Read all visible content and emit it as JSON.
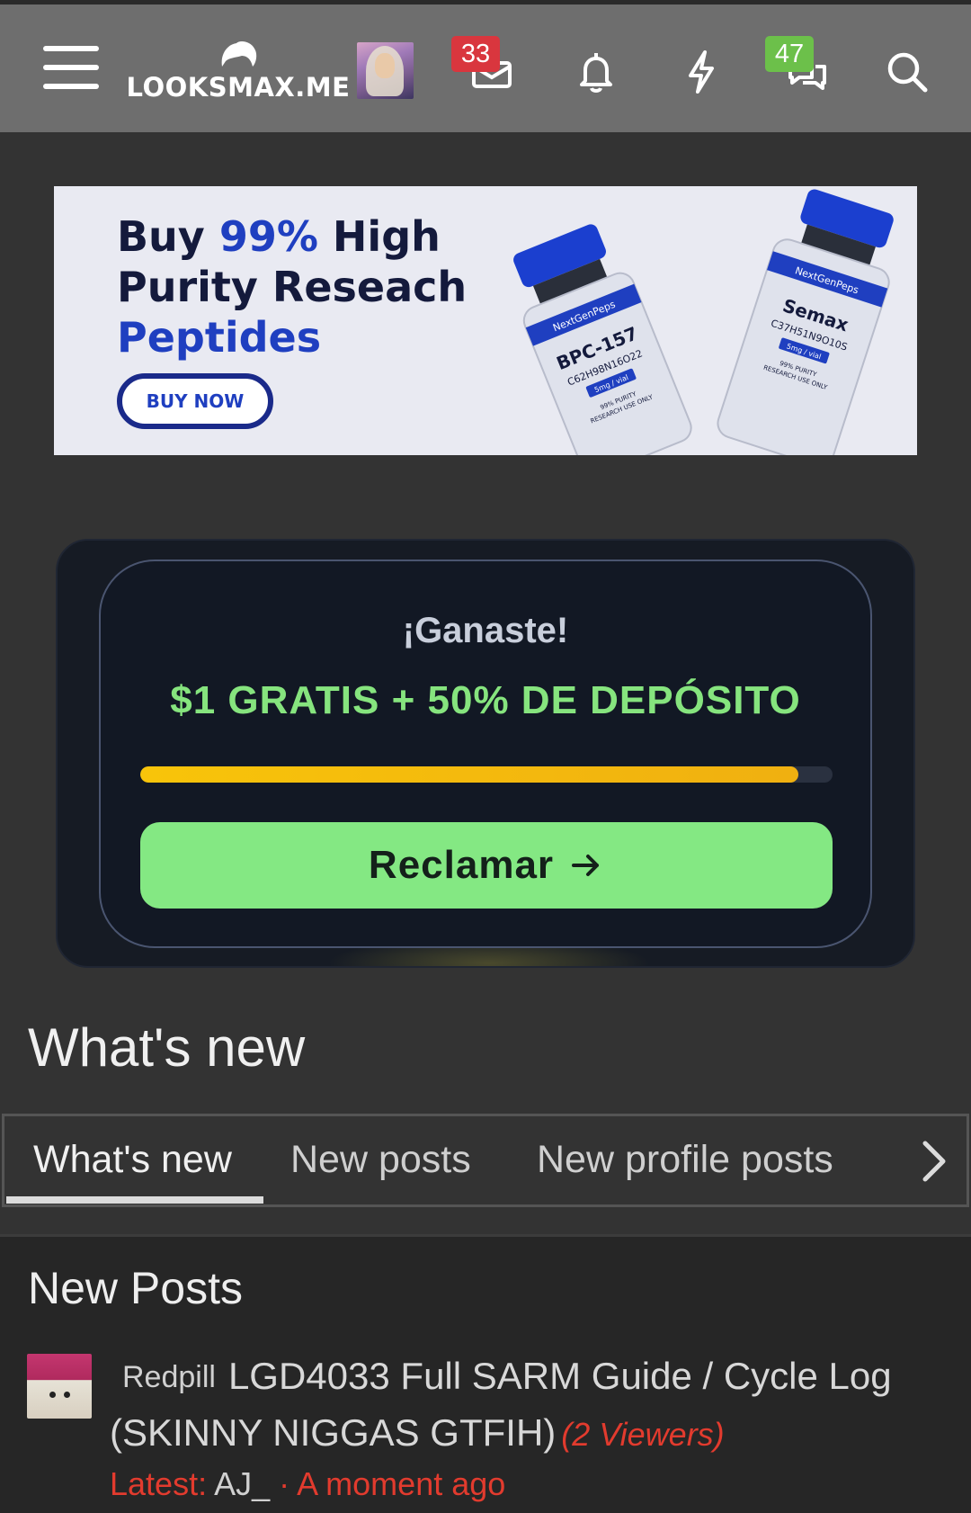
{
  "header": {
    "menu_icon": "hamburger-icon",
    "logo_text": "LOOKSMAX.ME",
    "inbox_badge": "33",
    "chats_badge": "47",
    "icons": [
      "inbox-icon",
      "bell-icon",
      "bolt-icon",
      "chats-icon",
      "search-icon"
    ]
  },
  "ad": {
    "line1_a": "Buy ",
    "line1_b": "99%",
    "line1_c": " High",
    "line2": "Purity Reseach",
    "line3": "Peptides",
    "button": "BUY NOW",
    "vial1_brand": "NextGenPeps",
    "vial1_name": "BPC-157",
    "vial1_formula": "C62H98N16O22",
    "vial1_dose": "5mg / vial",
    "vial1_note1": "99% PURITY",
    "vial1_note2": "RESEARCH USE ONLY",
    "vial2_brand": "NextGenPeps",
    "vial2_name": "Semax",
    "vial2_formula": "C37H51N9O10S",
    "vial2_dose": "5mg / vial",
    "vial2_note1": "99% PURITY",
    "vial2_note2": "RESEARCH USE ONLY"
  },
  "promo": {
    "title": "¡Ganaste!",
    "subtitle": "$1 GRATIS + 50% DE DEPÓSITO",
    "progress_percent": 95,
    "button": "Reclamar"
  },
  "whats_new": {
    "title": "What's new",
    "tabs": [
      "What's new",
      "New posts",
      "New profile posts"
    ],
    "active_tab": 0
  },
  "new_posts": {
    "title": "New Posts",
    "post": {
      "prefix": "Redpill",
      "title_line1": "LGD4033 Full SARM Guide / Cycle Log",
      "title_line2": "(SKINNY NIGGAS GTFIH)",
      "viewers": "(2 Viewers)",
      "latest_label": "Latest: ",
      "latest_user": "AJ_",
      "latest_time": " · A moment ago"
    }
  },
  "colors": {
    "header_bg": "#6e6e6e",
    "page_bg": "#333333",
    "badge_red": "#d9363e",
    "badge_green": "#6cc04a",
    "promo_green": "#84e883",
    "progress_yellow": "#f8c40a",
    "latest_red": "#e23b2e"
  }
}
